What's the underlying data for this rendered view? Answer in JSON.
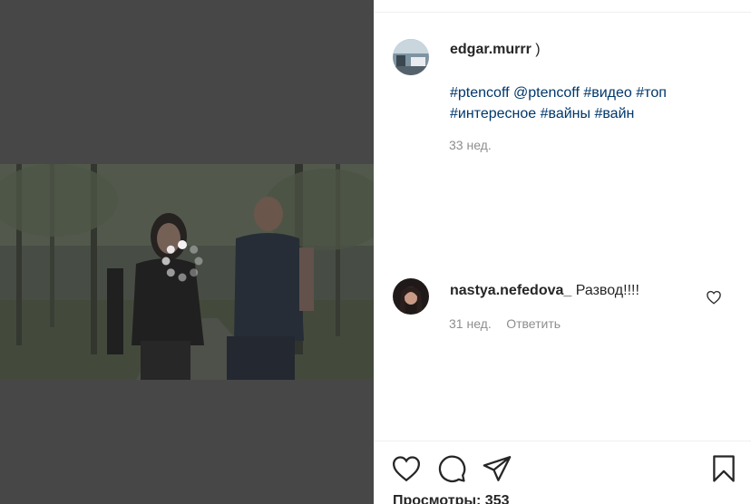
{
  "post": {
    "author": {
      "username": "edgar.murrr",
      "caption_suffix": ")"
    },
    "caption_tags": [
      "#ptencoff",
      "@ptencoff",
      "#видео",
      "#топ",
      "#интересное",
      "#вайны",
      "#вайн"
    ],
    "time": "33 нед."
  },
  "comments": [
    {
      "username": "nastya.nefedova_",
      "text": "Развод!!!!",
      "time": "31 нед.",
      "reply_label": "Ответить"
    }
  ],
  "views": {
    "label": "Просмотры:",
    "count": "353"
  },
  "icons": {
    "like": "heart-icon",
    "comment": "comment-icon",
    "share": "send-icon",
    "save": "bookmark-icon",
    "comment_like": "heart-icon"
  },
  "colors": {
    "hashtag": "#00376b",
    "meta": "#8e8e8e",
    "text": "#262626",
    "media_bg": "#474747"
  }
}
